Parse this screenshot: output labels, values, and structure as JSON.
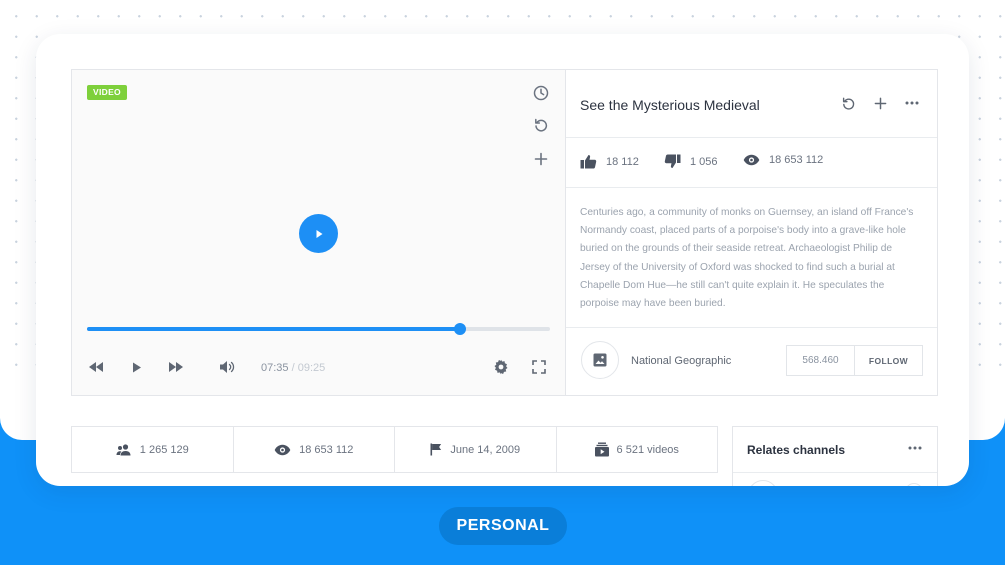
{
  "player": {
    "badge": "VIDEO",
    "progress": 0.805,
    "time_current": "07:35",
    "time_total": "/ 09:25"
  },
  "info": {
    "title": "See the Mysterious Medieval",
    "likes": "18 112",
    "dislikes": "1 056",
    "views": "18 653 112",
    "description": "Centuries ago, a community of monks on Guernsey, an island off France's Normandy coast, placed parts of a porpoise's body into a grave-like hole buried on the grounds of their seaside retreat. Archaeologist Philip de Jersey of the University of Oxford was shocked to find such a burial at Chapelle Dom Hue—he still can't quite explain it. He speculates the porpoise may have been buried."
  },
  "channel": {
    "name": "National Geographic",
    "followers": "568.460",
    "follow_label": "FOLLOW"
  },
  "stats_bar": {
    "subscribers": "1 265 129",
    "views": "18 653 112",
    "date": "June 14, 2009",
    "videos": "6 521 videos"
  },
  "related": {
    "title": "Relates channels"
  },
  "footer": {
    "label": "PERSONAL"
  },
  "colors": {
    "accent": "#1d8ff5",
    "badge": "#7ed03b",
    "background_blue": "#0f91f8"
  }
}
